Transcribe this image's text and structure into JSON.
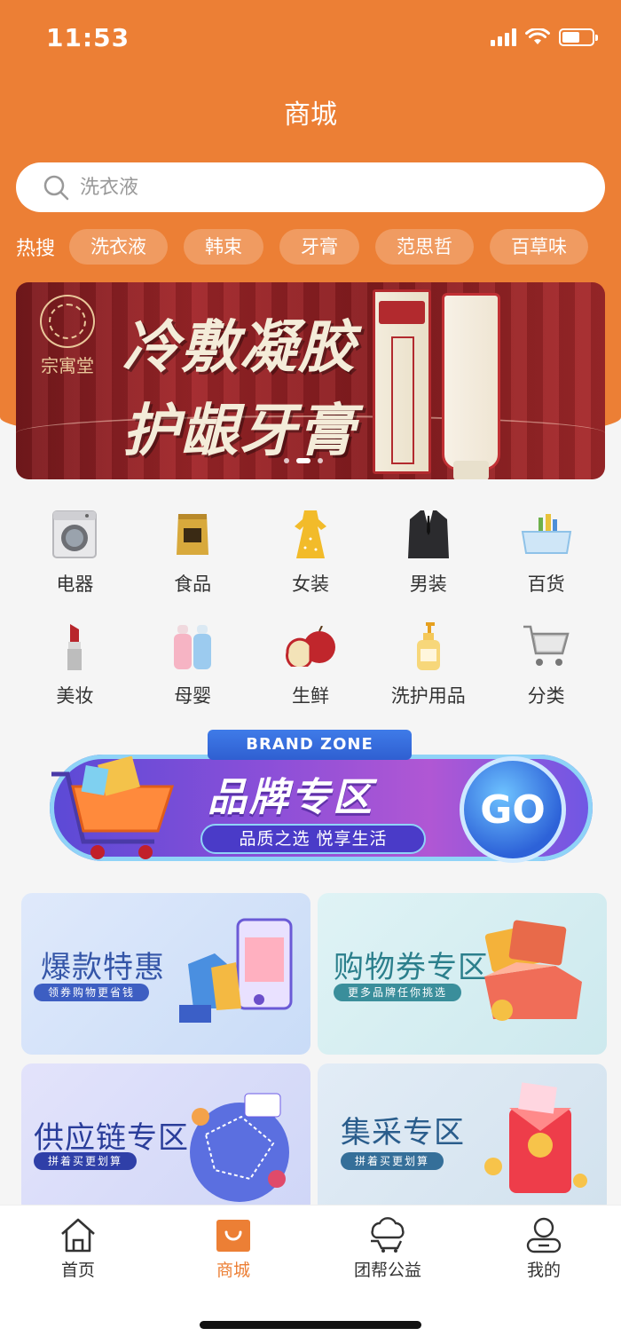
{
  "status_bar": {
    "time": "11:53"
  },
  "header": {
    "title": "商城"
  },
  "search": {
    "placeholder": "洗衣液"
  },
  "hot_search": {
    "label": "热搜",
    "tags": [
      "洗衣液",
      "韩束",
      "牙膏",
      "范思哲",
      "百草味"
    ]
  },
  "banner": {
    "line1": "冷敷凝胶",
    "line2": "护龈牙膏",
    "logo_text": "宗寓堂",
    "slide_count": 3,
    "active_slide": 2
  },
  "categories": [
    {
      "label": "电器",
      "icon": "washing-machine-icon"
    },
    {
      "label": "食品",
      "icon": "food-bag-icon"
    },
    {
      "label": "女装",
      "icon": "dress-icon"
    },
    {
      "label": "男装",
      "icon": "suit-icon"
    },
    {
      "label": "百货",
      "icon": "storage-box-icon"
    },
    {
      "label": "美妆",
      "icon": "lipstick-icon"
    },
    {
      "label": "母婴",
      "icon": "baby-bottle-icon"
    },
    {
      "label": "生鲜",
      "icon": "apple-icon"
    },
    {
      "label": "洗护用品",
      "icon": "lotion-bottle-icon"
    },
    {
      "label": "分类",
      "icon": "shopping-cart-icon"
    }
  ],
  "brand_zone": {
    "ribbon": "BRAND ZONE",
    "title": "品牌专区",
    "subtitle": "品质之选 悦享生活",
    "go": "GO"
  },
  "promos": [
    {
      "title": "爆款特惠",
      "tag": "领券购物更省钱"
    },
    {
      "title": "购物券专区",
      "tag": "更多品牌任你挑选"
    },
    {
      "title": "供应链专区",
      "tag": "拼着买更划算"
    },
    {
      "title": "集采专区",
      "tag": "拼着买更划算"
    }
  ],
  "tab_bar": {
    "items": [
      {
        "label": "首页",
        "icon": "home-icon"
      },
      {
        "label": "商城",
        "icon": "shopping-bag-icon"
      },
      {
        "label": "团帮公益",
        "icon": "charity-icon"
      },
      {
        "label": "我的",
        "icon": "profile-icon"
      }
    ],
    "active": "商城"
  },
  "colors": {
    "brand_orange": "#ec7f35",
    "background": "#f5f5f5"
  }
}
